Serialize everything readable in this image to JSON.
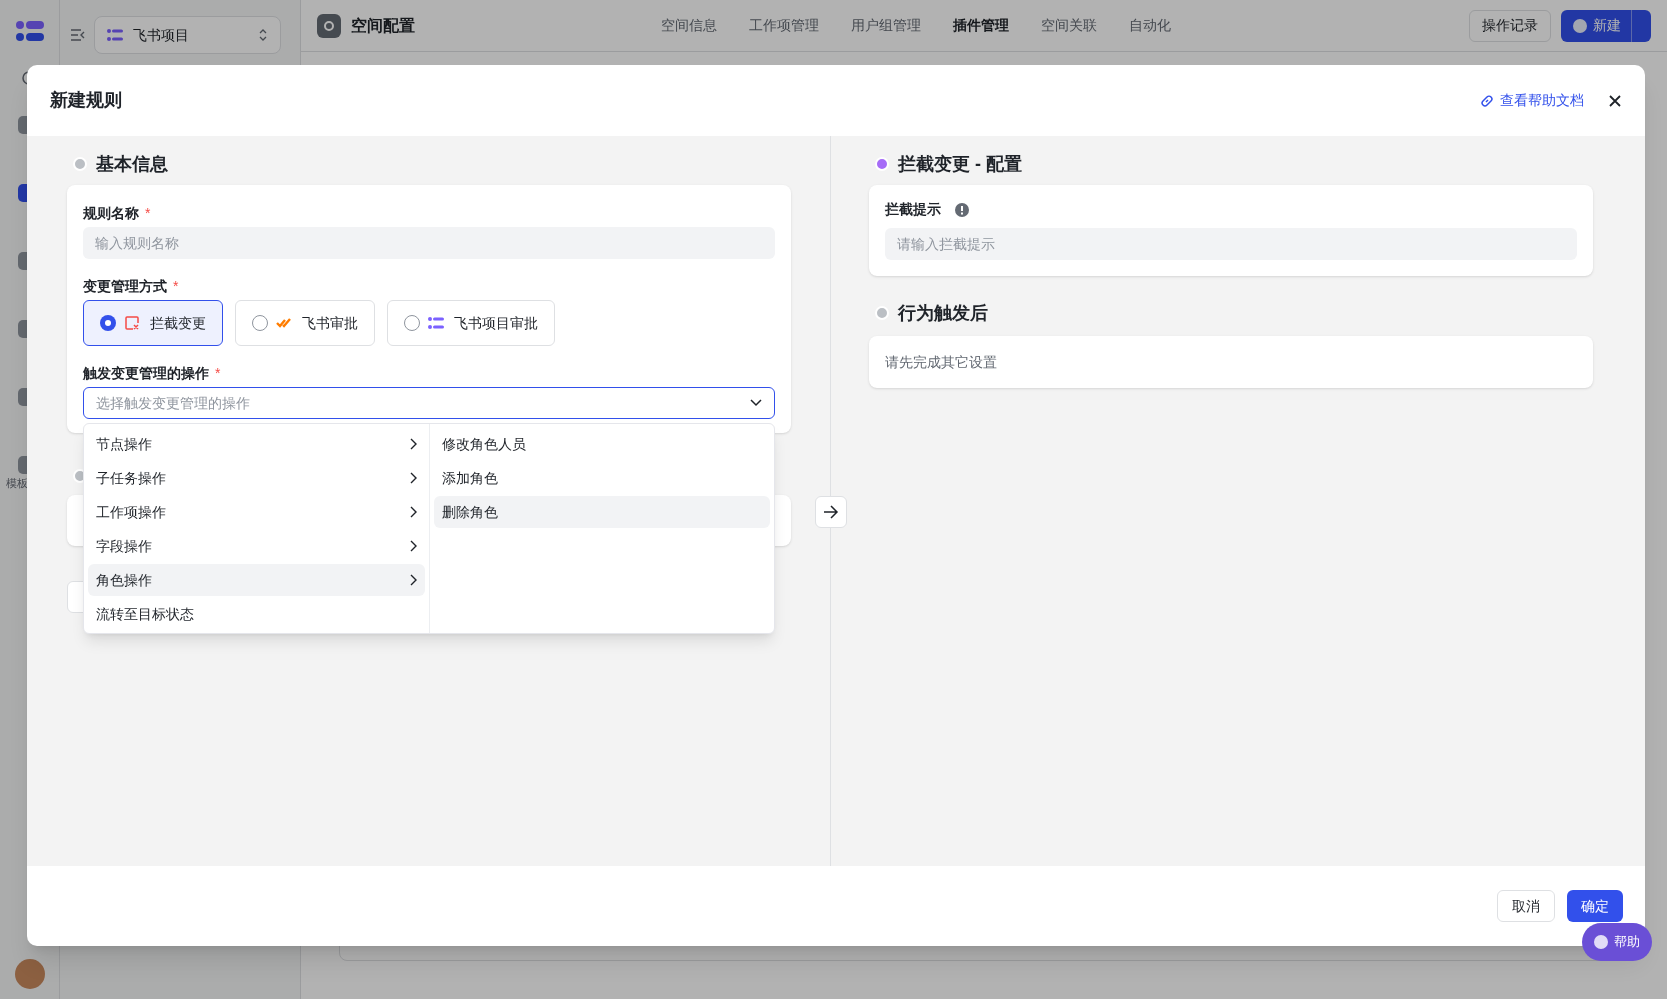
{
  "app": {
    "nav_items": [
      {
        "selected": false
      },
      {
        "selected": true
      },
      {
        "selected": false
      },
      {
        "selected": false
      },
      {
        "selected": false
      },
      {
        "label": "模板",
        "selected": false
      }
    ],
    "project_selector": {
      "label": "飞书项目"
    },
    "page_title": "空间配置",
    "tabs": [
      {
        "label": "空间信息",
        "selected": false
      },
      {
        "label": "工作项管理",
        "selected": false
      },
      {
        "label": "用户组管理",
        "selected": false
      },
      {
        "label": "插件管理",
        "selected": true
      },
      {
        "label": "空间关联",
        "selected": false
      },
      {
        "label": "自动化",
        "selected": false
      }
    ],
    "history_button": "操作记录",
    "new_button": "新建",
    "help_button": "帮助"
  },
  "dialog": {
    "title": "新建规则",
    "help_link": "查看帮助文档",
    "basic_section": {
      "title": "基本信息",
      "active": false,
      "rule_name": {
        "label": "规则名称",
        "required_mark": "*",
        "placeholder": "输入规则名称"
      },
      "mode": {
        "label": "变更管理方式",
        "required_mark": "*",
        "options": [
          {
            "label": "拦截变更",
            "kind": "block",
            "selected": true
          },
          {
            "label": "飞书审批",
            "kind": "approval",
            "selected": false
          },
          {
            "label": "飞书项目审批",
            "kind": "project",
            "selected": false
          }
        ]
      },
      "trigger": {
        "label": "触发变更管理的操作",
        "required_mark": "*",
        "placeholder": "选择触发变更管理的操作",
        "expanded": true,
        "categories": [
          {
            "label": "节点操作",
            "has_submenu": true,
            "selected": false
          },
          {
            "label": "子任务操作",
            "has_submenu": true,
            "selected": false
          },
          {
            "label": "工作项操作",
            "has_submenu": true,
            "selected": false
          },
          {
            "label": "字段操作",
            "has_submenu": true,
            "selected": false
          },
          {
            "label": "角色操作",
            "has_submenu": true,
            "selected": true
          },
          {
            "label": "流转至目标状态",
            "has_submenu": false,
            "selected": false
          }
        ],
        "submenu": [
          {
            "label": "修改角色人员",
            "selected": false
          },
          {
            "label": "添加角色",
            "selected": false
          },
          {
            "label": "删除角色",
            "selected": true
          }
        ]
      }
    },
    "config_section": {
      "title": "拦截变更 - 配置",
      "active": true,
      "tip": {
        "label": "拦截提示",
        "placeholder": "请输入拦截提示"
      }
    },
    "after_section": {
      "title": "行为触发后",
      "active": false,
      "message": "请先完成其它设置"
    },
    "cancel_button": "取消",
    "confirm_button": "确定"
  }
}
